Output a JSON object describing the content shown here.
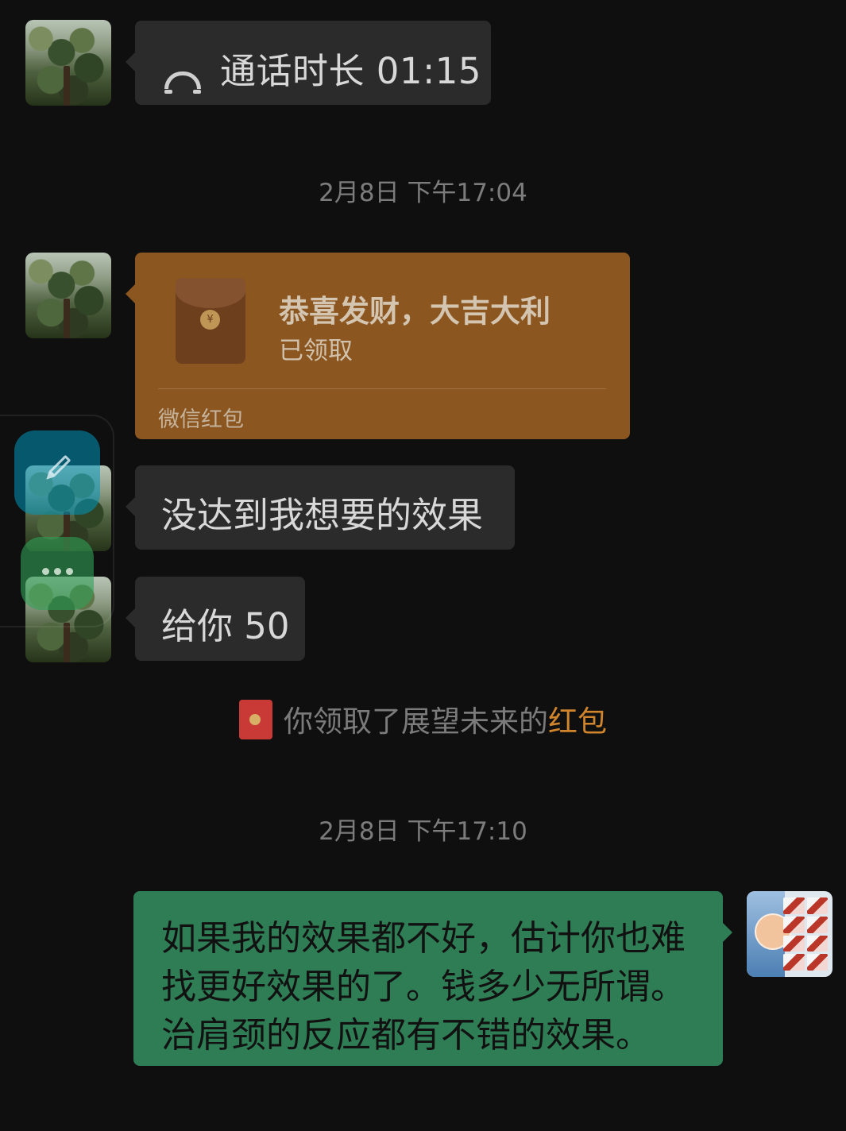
{
  "chat": {
    "call_record": {
      "text": "通话时长 01:15",
      "icon": "phone-call-icon"
    },
    "timestamps": [
      "2月8日 下午17:04",
      "2月8日 下午17:10"
    ],
    "red_packet": {
      "title": "恭喜发财，大吉大利",
      "status": "已领取",
      "footer": "微信红包",
      "icon": "red-packet-icon"
    },
    "messages": [
      "没达到我想要的效果",
      "给你 50"
    ],
    "system_notice": {
      "prefix": "你领取了展望未来的",
      "highlight": "红包",
      "icon": "red-packet-small-icon",
      "highlight_color": "#d0852d"
    },
    "outgoing_message": "如果我的效果都不好，估计你也难\n找更好效果的了。钱多少无所谓。\n治肩颈的反应都有不错的效果。"
  },
  "colors": {
    "background": "#0f0f0f",
    "incoming_bubble": "#2b2b2b",
    "red_packet_bubble": "#8b5620",
    "outgoing_bubble": "#2f7d55"
  },
  "floating_tools": {
    "edit_icon": "pencil-icon",
    "more_icon": "more-dots-icon"
  }
}
